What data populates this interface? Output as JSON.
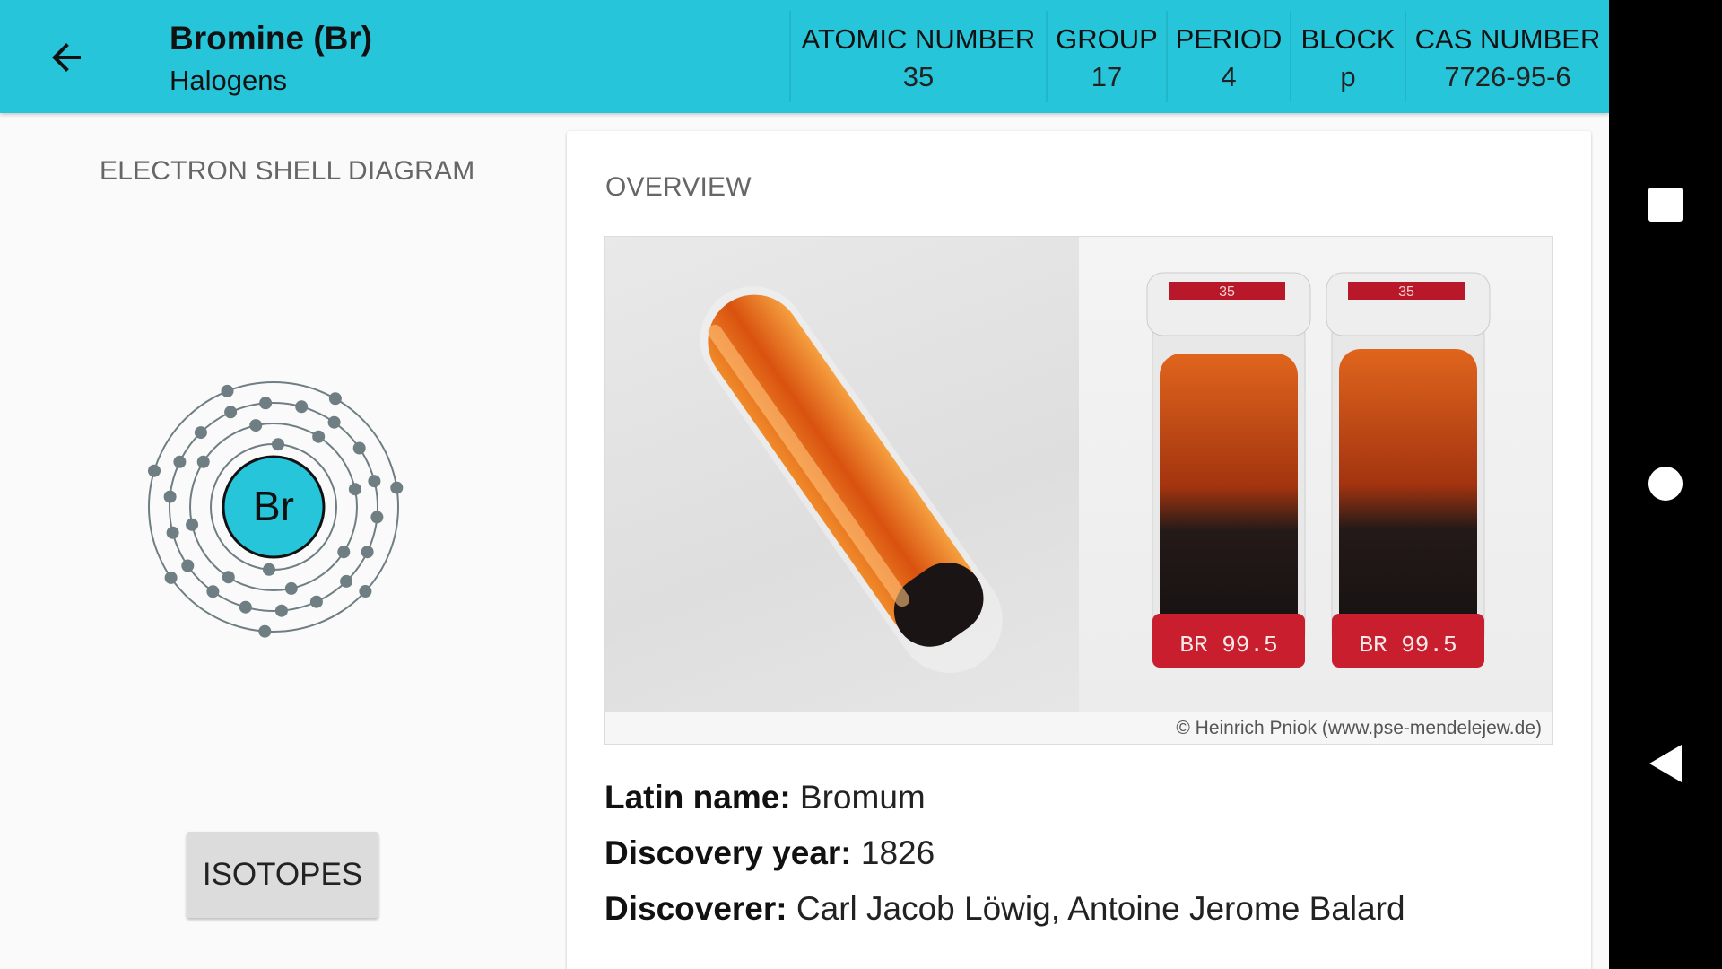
{
  "header": {
    "title": "Bromine (Br)",
    "subtitle": "Halogens",
    "stats": [
      {
        "label": "ATOMIC NUMBER",
        "value": "35"
      },
      {
        "label": "GROUP",
        "value": "17"
      },
      {
        "label": "PERIOD",
        "value": "4"
      },
      {
        "label": "BLOCK",
        "value": "p"
      },
      {
        "label": "CAS NUMBER",
        "value": "7726-95-6"
      }
    ]
  },
  "left": {
    "diagram_label": "ELECTRON SHELL DIAGRAM",
    "nucleus_symbol": "Br",
    "electron_shells": [
      2,
      8,
      18,
      7
    ],
    "isotopes_button": "ISOTOPES"
  },
  "overview": {
    "label": "OVERVIEW",
    "photo_credit": "© Heinrich Pniok (www.pse-mendelejew.de)",
    "vial_label_number": "35",
    "vial_band_text": "BR 99.5",
    "latin_name_label": "Latin name:",
    "latin_name": "Bromum",
    "discovery_year_label": "Discovery year:",
    "discovery_year": "1826",
    "discoverer_label": "Discoverer:",
    "discoverer": "Carl Jacob Löwig, Antoine Jerome Balard"
  },
  "colors": {
    "appbar": "#26c5da",
    "nucleus": "#26c5da",
    "electron": "#6f7e82",
    "bromine_liquid": "#e0651d"
  },
  "icons": {
    "back": "arrow-left-icon",
    "recent": "square-icon",
    "home": "circle-icon",
    "nav_back": "triangle-left-icon"
  }
}
